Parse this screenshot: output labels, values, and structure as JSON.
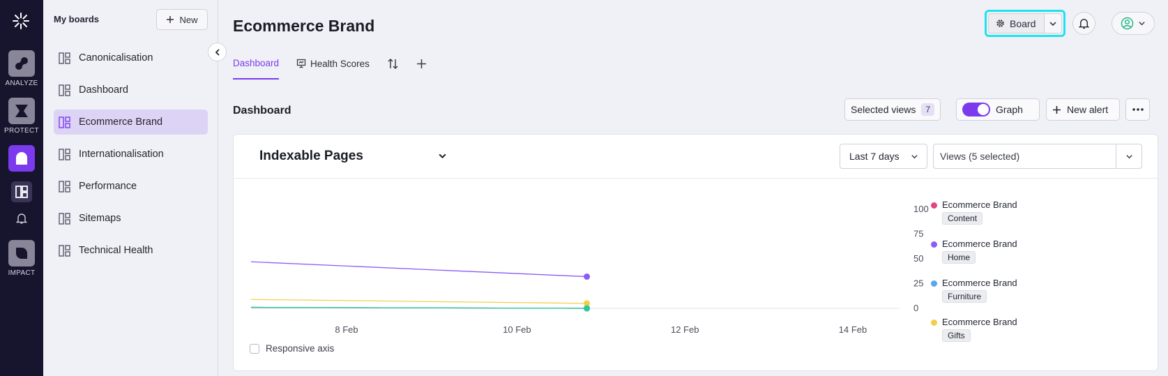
{
  "rail": {
    "items": [
      {
        "label": "ANALYZE",
        "icon": "analyze-icon"
      },
      {
        "label": "PROTECT",
        "icon": "protect-icon"
      },
      {
        "label": "",
        "icon": "board-nav-icon"
      },
      {
        "label": "IMPACT",
        "icon": "impact-icon"
      }
    ]
  },
  "boards": {
    "title": "My boards",
    "new_label": "New",
    "items": [
      {
        "label": "Canonicalisation"
      },
      {
        "label": "Dashboard"
      },
      {
        "label": "Ecommerce Brand"
      },
      {
        "label": "Internationalisation"
      },
      {
        "label": "Performance"
      },
      {
        "label": "Sitemaps"
      },
      {
        "label": "Technical Health"
      }
    ]
  },
  "header": {
    "title": "Ecommerce Brand",
    "board_label": "Board"
  },
  "tabs": [
    {
      "label": "Dashboard"
    },
    {
      "label": "Health Scores"
    }
  ],
  "section": {
    "title": "Dashboard",
    "selected_views_label": "Selected views",
    "selected_views_count": "7",
    "graph_label": "Graph",
    "new_alert_label": "New alert"
  },
  "card": {
    "metric_title": "Indexable Pages",
    "range": "Last 7 days",
    "views": "Views (5 selected)",
    "responsive_axis_label": "Responsive axis"
  },
  "chart_data": {
    "type": "line",
    "x_ticks": [
      "8 Feb",
      "10 Feb",
      "12 Feb",
      "14 Feb"
    ],
    "y_ticks": [
      "100",
      "75",
      "50",
      "25",
      "0"
    ],
    "ylim": [
      0,
      100
    ],
    "x": [
      "7 Feb",
      "11 Feb"
    ],
    "series": [
      {
        "name": "Ecommerce Brand",
        "tag": "Content",
        "color": "#e4447e",
        "values": [
          1,
          0
        ]
      },
      {
        "name": "Ecommerce Brand",
        "tag": "Home",
        "color": "#8b5cf6",
        "values": [
          47,
          32
        ]
      },
      {
        "name": "Ecommerce Brand",
        "tag": "Furniture",
        "color": "#5ba4f2",
        "values": [
          1,
          0
        ]
      },
      {
        "name": "Ecommerce Brand",
        "tag": "Gifts",
        "color": "#f4ce4a",
        "values": [
          9,
          5
        ]
      },
      {
        "color": "#2ec99a",
        "values": [
          1,
          0
        ]
      }
    ]
  }
}
